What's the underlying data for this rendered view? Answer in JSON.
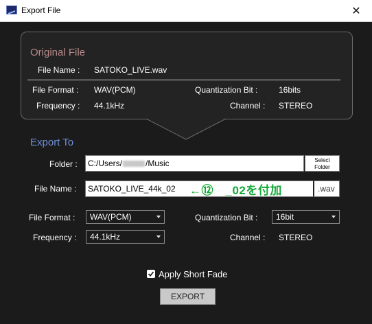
{
  "window": {
    "title": "Export File",
    "close_glyph": "✕",
    "icon": "app-icon"
  },
  "original": {
    "title": "Original File",
    "file_name_label": "File Name :",
    "file_name_value": "SATOKO_LIVE.wav",
    "file_format_label": "File Format :",
    "file_format_value": "WAV(PCM)",
    "quantization_label": "Quantization Bit :",
    "quantization_value": "16bits",
    "frequency_label": "Frequency :",
    "frequency_value": "44.1kHz",
    "channel_label": "Channel :",
    "channel_value": "STEREO"
  },
  "export": {
    "title": "Export To",
    "folder_label": "Folder :",
    "folder_prefix": "C:/Users/",
    "folder_suffix": "/Music",
    "select_folder_line1": "Select",
    "select_folder_line2": "Folder",
    "file_name_label": "File Name :",
    "file_name_value": "SATOKO_LIVE_44k_02",
    "annotation": "←⑫　_02を付加",
    "extension": ".wav",
    "file_format_label": "File Format :",
    "file_format_selected": "WAV(PCM)",
    "quantization_label": "Quantization Bit :",
    "quantization_selected": "16bit",
    "frequency_label": "Frequency :",
    "frequency_selected": "44.1kHz",
    "channel_label": "Channel :",
    "channel_value": "STEREO",
    "apply_fade_label": "Apply Short Fade",
    "apply_fade_checked": true,
    "export_button": "EXPORT"
  },
  "colors": {
    "background": "#1b1b1b",
    "original_title": "#b98a8a",
    "export_title": "#6f8fd9",
    "annotation": "#14a838"
  }
}
